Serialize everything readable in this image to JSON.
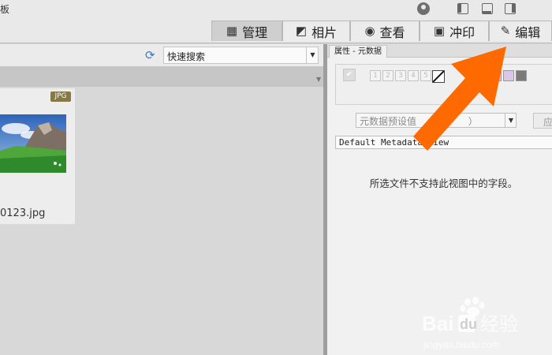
{
  "titlebar": {
    "title_fragment": "板"
  },
  "modes": [
    {
      "label": "管理",
      "icon": "grid-icon",
      "active": true
    },
    {
      "label": "相片",
      "icon": "photos-icon",
      "active": false
    },
    {
      "label": "查看",
      "icon": "eye-icon",
      "active": false
    },
    {
      "label": "冲印",
      "icon": "print-icon",
      "active": false
    },
    {
      "label": "编辑",
      "icon": "edit-icon",
      "active": false
    }
  ],
  "filter": {
    "search_label": "快速搜索"
  },
  "thumbnail": {
    "badge": "JPG",
    "filename": "0123.jpg"
  },
  "properties": {
    "tab_label": "属性 - 元数据",
    "stars": [
      "1",
      "2",
      "3",
      "4",
      "5"
    ],
    "color_labels": [
      "#f2bcbc",
      "#d8c7e6",
      "#7a7a7a"
    ],
    "preset_placeholder": "元数据预设值",
    "preset_suffix": "）",
    "apply_label": "应",
    "view_label": "Default Metadata View",
    "message": "所选文件不支持此视图中的字段。"
  },
  "watermark": {
    "brand": "Baidu",
    "suffix": "经验",
    "url": "jingyan.baidu.com"
  },
  "colors": {
    "arrow": "#ff6a00",
    "accent": "#3a78c8"
  }
}
